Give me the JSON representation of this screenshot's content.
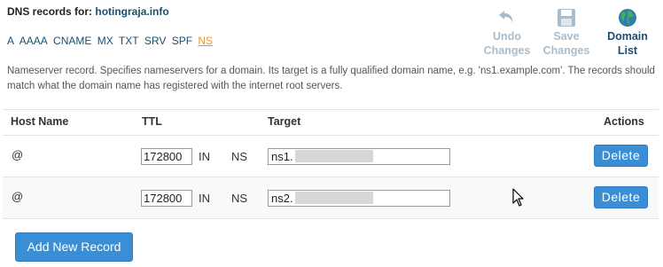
{
  "header": {
    "title_prefix": "DNS records for: ",
    "domain": "hotingraja.info"
  },
  "record_types": {
    "items": [
      "A",
      "AAAA",
      "CNAME",
      "MX",
      "TXT",
      "SRV",
      "SPF",
      "NS"
    ],
    "active": "NS"
  },
  "toolbar": {
    "undo": {
      "line1": "Undo",
      "line2": "Changes",
      "icon": "undo-icon",
      "enabled": false
    },
    "save": {
      "line1": "Save",
      "line2": "Changes",
      "icon": "save-icon",
      "enabled": false
    },
    "domain_list": {
      "line1": "Domain",
      "line2": "List",
      "icon": "globe-icon",
      "enabled": true
    }
  },
  "description": "Nameserver record. Specifies nameservers for a domain. Its target is a fully qualified domain name, e.g. 'ns1.example.com'. The records should match what the domain name has registered with the internet root servers.",
  "table": {
    "headers": {
      "host": "Host Name",
      "ttl": "TTL",
      "target": "Target",
      "actions": "Actions"
    },
    "rows": [
      {
        "host": "@",
        "ttl": "172800",
        "class": "IN",
        "type": "NS",
        "target_visible": "ns1.",
        "action": "Delete"
      },
      {
        "host": "@",
        "ttl": "172800",
        "class": "IN",
        "type": "NS",
        "target_visible": "ns2.",
        "action": "Delete"
      }
    ]
  },
  "add_button_label": "Add New Record",
  "colors": {
    "primary_button": "#3a8ed6",
    "link": "#1a4f6e",
    "active_type": "#e8962f",
    "disabled_tool": "#a9bccb"
  }
}
